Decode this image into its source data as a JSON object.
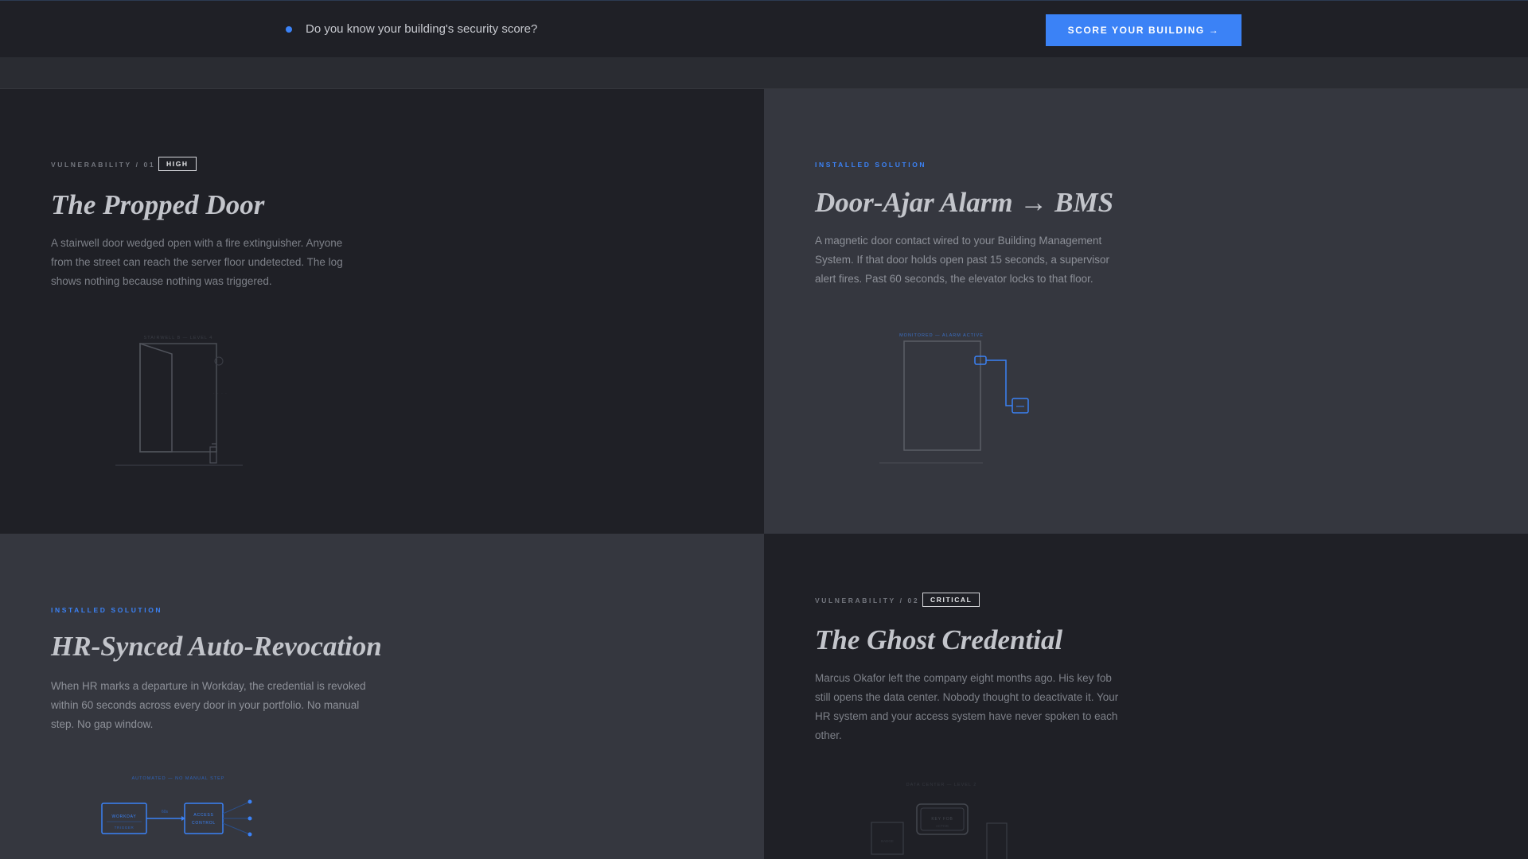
{
  "banner": {
    "question": "Do you know your building's security score?",
    "cta_label": "SCORE YOUR BUILDING →"
  },
  "colors": {
    "accent": "#3b82f6",
    "dark_panel": "#1f2026",
    "light_panel": "#35373f"
  },
  "panels": [
    {
      "kind": "vulnerability",
      "eyebrow": "VULNERABILITY / 01",
      "severity": "HIGH",
      "title": "The Propped Door",
      "description": "A stairwell door wedged open with a fire extinguisher. Anyone from the street can reach the server floor undetected. The log shows nothing because nothing was triggered.",
      "illustration_caption": "STAIRWELL B — LEVEL 4"
    },
    {
      "kind": "solution",
      "eyebrow": "INSTALLED SOLUTION",
      "title": "Door-Ajar Alarm → BMS",
      "description": "A magnetic door contact wired to your Building Management System. If that door holds open past 15 seconds, a supervisor alert fires. Past 60 seconds, the elevator locks to that floor.",
      "illustration_caption": "MONITORED — ALARM ACTIVE"
    },
    {
      "kind": "solution",
      "eyebrow": "INSTALLED SOLUTION",
      "title": "HR-Synced Auto-Revocation",
      "description": "When HR marks a departure in Workday, the credential is revoked within 60 seconds across every door in your portfolio. No manual step. No gap window.",
      "illustration_caption": "AUTOMATED — NO MANUAL STEP",
      "diagram": {
        "box1": "WORKDAY",
        "box1_sub": "TRIGGER",
        "arrow": "60s",
        "box2_line1": "ACCESS",
        "box2_line2": "CONTROL"
      }
    },
    {
      "kind": "vulnerability",
      "eyebrow": "VULNERABILITY / 02",
      "severity": "CRITICAL",
      "title": "The Ghost Credential",
      "description": "Marcus Okafor left the company eight months ago. His key fob still opens the data center. Nobody thought to deactivate it. Your HR system and your access system have never spoken to each other.",
      "illustration_caption": "DATA CENTER — LEVEL 2",
      "diagram": {
        "reader": "KEY FOB",
        "reader_sub": "ACTIVE",
        "left_box": "BADGE"
      }
    }
  ]
}
